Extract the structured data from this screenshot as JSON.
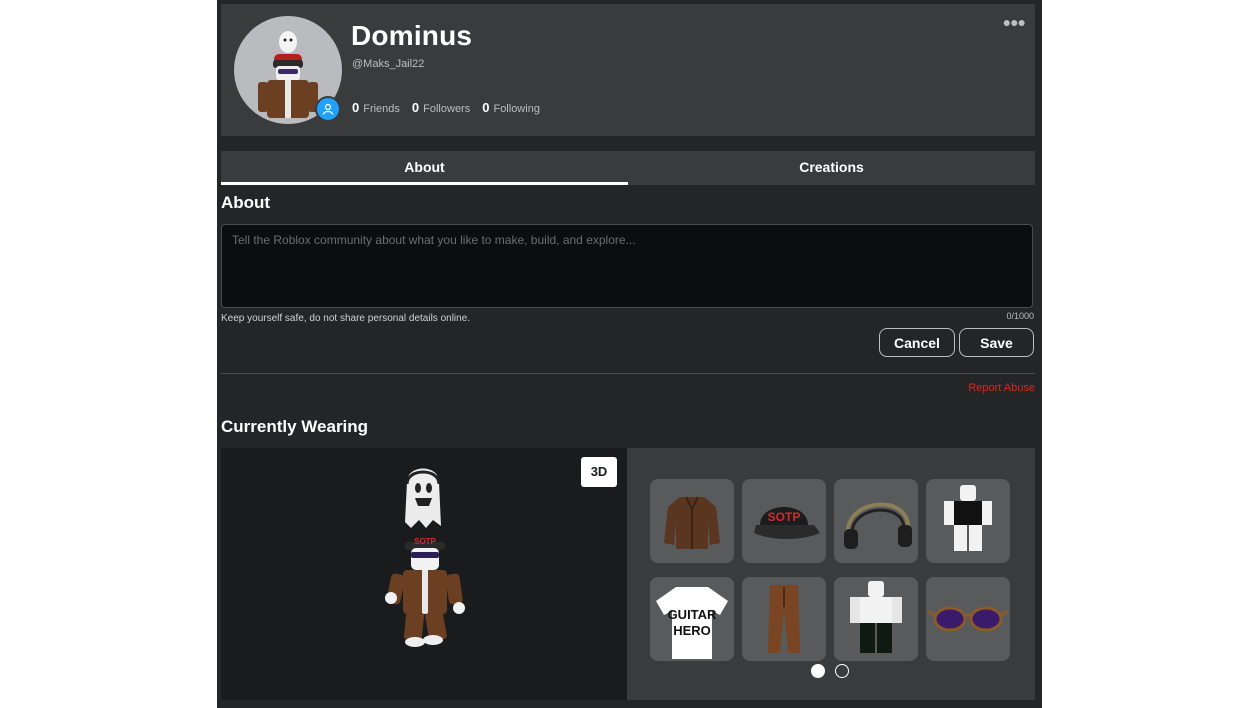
{
  "profile": {
    "display_name": "Dominus",
    "username": "@Maks_Jail22",
    "stats": [
      {
        "count": "0",
        "label": "Friends"
      },
      {
        "count": "0",
        "label": "Followers"
      },
      {
        "count": "0",
        "label": "Following"
      }
    ],
    "more_icon": "ellipsis-icon",
    "presence_icon": "person-icon"
  },
  "tabs": [
    {
      "label": "About",
      "active": true
    },
    {
      "label": "Creations",
      "active": false
    }
  ],
  "about": {
    "title": "About",
    "value": "",
    "placeholder": "Tell the Roblox community about what you like to make, build, and explore...",
    "hint": "Keep yourself safe, do not share personal details online.",
    "counter": "0/1000",
    "cancel_label": "Cancel",
    "save_label": "Save",
    "report_label": "Report Abuse"
  },
  "wearing": {
    "title": "Currently Wearing",
    "toggle_label": "3D",
    "items": [
      {
        "name": "brown-jacket"
      },
      {
        "name": "black-cap"
      },
      {
        "name": "headphones"
      },
      {
        "name": "black-shirt-character"
      },
      {
        "name": "guitar-hero-tshirt"
      },
      {
        "name": "brown-pants"
      },
      {
        "name": "white-character"
      },
      {
        "name": "purple-sunglasses"
      }
    ],
    "cap_text": "SOTP",
    "shirt_text": [
      "GUITAR",
      "HERO"
    ],
    "pages": 2,
    "current_page": 1
  },
  "colors": {
    "background": "#232527",
    "panel": "#393b3d",
    "presence": "#1ea1ff",
    "report": "#e2231a"
  }
}
